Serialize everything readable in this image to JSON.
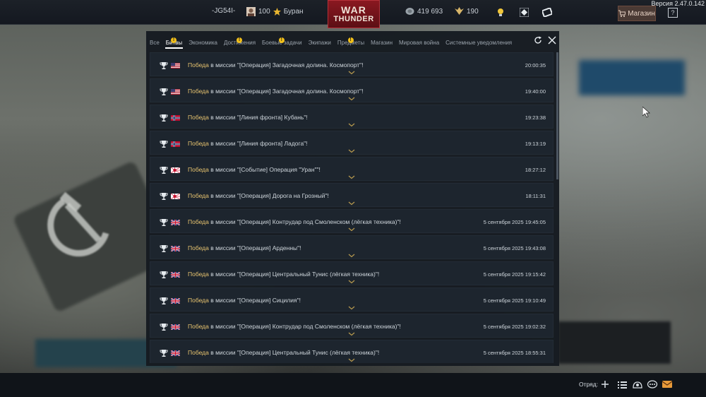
{
  "version": "Версия 2.47.0.142",
  "topbar": {
    "player": "-JG54I-",
    "golden_eagles": "100",
    "nickname": "Буран",
    "logo_line1": "WAR",
    "logo_line2": "THUNDER",
    "silver_lions": "419 693",
    "rp": "190",
    "shop_label": "Магазин",
    "help_label": "?"
  },
  "tabs": [
    {
      "label": "Все",
      "badge": false
    },
    {
      "label": "Битвы",
      "badge": true,
      "active": true
    },
    {
      "label": "Экономика",
      "badge": false
    },
    {
      "label": "Достижения",
      "badge": true
    },
    {
      "label": "Боевые задачи",
      "badge": true
    },
    {
      "label": "Экипажи",
      "badge": false
    },
    {
      "label": "Предметы",
      "badge": true
    },
    {
      "label": "Магазин",
      "badge": false
    },
    {
      "label": "Мировая война",
      "badge": false
    },
    {
      "label": "Системные уведомления",
      "badge": false
    }
  ],
  "badge_symbol": "!",
  "messages": [
    {
      "win": "Победа",
      "rest": " в миссии \"[Операция] Загадочная долина. Космопорт\"!",
      "time": "20:00:35",
      "flag": "usa"
    },
    {
      "win": "Победа",
      "rest": " в миссии \"[Операция] Загадочная долина. Космопорт\"!",
      "time": "19:40:00",
      "flag": "usa"
    },
    {
      "win": "Победа",
      "rest": " в миссии \"[Линия фронта] Кубань\"!",
      "time": "19:23:38",
      "flag": "norway"
    },
    {
      "win": "Победа",
      "rest": " в миссии \"[Линия фронта] Ладога\"!",
      "time": "19:13:19",
      "flag": "norway"
    },
    {
      "win": "Победа",
      "rest": " в миссии \"[Событие] Операция \"Уран\"\"!",
      "time": "18:27:12",
      "flag": "japan"
    },
    {
      "win": "Победа",
      "rest": " в миссии \"[Операция] Дорога на Грозный\"!",
      "time": "18:11:31",
      "flag": "japan"
    },
    {
      "win": "Победа",
      "rest": " в миссии \"[Операция] Контрудар под Смоленском (лёгкая техника)\"!",
      "time": "5 сентября 2025 19:45:05",
      "flag": "uk"
    },
    {
      "win": "Победа",
      "rest": " в миссии \"[Операция] Арденны\"!",
      "time": "5 сентября 2025 19:43:08",
      "flag": "uk"
    },
    {
      "win": "Победа",
      "rest": " в миссии \"[Операция] Центральный Тунис (лёгкая техника)\"!",
      "time": "5 сентября 2025 19:15:42",
      "flag": "uk"
    },
    {
      "win": "Победа",
      "rest": " в миссии \"[Операция] Сицилия\"!",
      "time": "5 сентября 2025 19:10:49",
      "flag": "uk"
    },
    {
      "win": "Победа",
      "rest": " в миссии \"[Операция] Контрудар под Смоленском (лёгкая техника)\"!",
      "time": "5 сентября 2025 19:02:32",
      "flag": "uk"
    },
    {
      "win": "Победа",
      "rest": " в миссии \"[Операция] Центральный Тунис (лёгкая техника)\"!",
      "time": "5 сентября 2025 18:55:31",
      "flag": "uk"
    }
  ],
  "bottombar": {
    "squad_label": "Отряд:"
  },
  "colors": {
    "win": "#e7c36f",
    "badge": "#f2c01a",
    "accent_red": "#8a1820"
  }
}
